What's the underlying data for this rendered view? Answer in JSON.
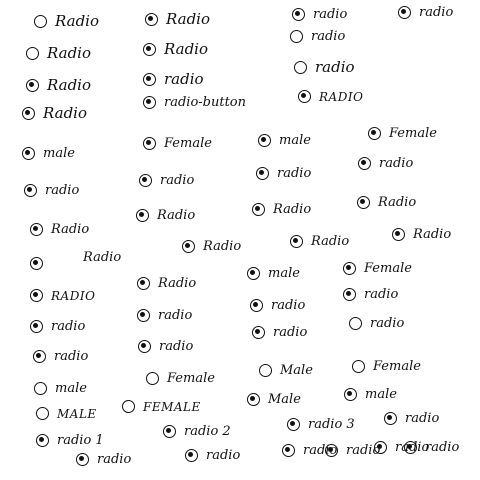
{
  "rows": [
    {
      "items": [
        {
          "label": "Radio",
          "selected": false
        },
        {
          "label": "Radio",
          "selected": true
        },
        {
          "label": "radio",
          "selected": true
        },
        {
          "label": "radio",
          "selected": true
        }
      ]
    },
    {
      "items": [
        {
          "label": "Radio",
          "selected": false
        },
        {
          "label": "Radio",
          "selected": true
        },
        {
          "label": "radio",
          "selected": false
        }
      ]
    },
    {
      "items": [
        {
          "label": "Radio",
          "selected": true
        },
        {
          "label": "radio",
          "selected": true
        },
        {
          "label": "radio",
          "selected": false
        }
      ]
    },
    {
      "items": [
        {
          "label": "Radio",
          "selected": true
        },
        {
          "label": "radio-button",
          "selected": true
        },
        {
          "label": "RADIO",
          "selected": true
        }
      ]
    },
    {
      "items": [
        {
          "label": "male",
          "selected": true
        },
        {
          "label": "Female",
          "selected": true
        },
        {
          "label": "male",
          "selected": true
        },
        {
          "label": "Female",
          "selected": true
        }
      ]
    },
    {
      "items": [
        {
          "label": "radio",
          "selected": true
        },
        {
          "label": "radio",
          "selected": true
        },
        {
          "label": "radio",
          "selected": true
        },
        {
          "label": "radio",
          "selected": true
        }
      ]
    },
    {
      "items": [
        {
          "label": "Radio",
          "selected": true
        },
        {
          "label": "Radio",
          "selected": true
        },
        {
          "label": "Radio",
          "selected": true
        },
        {
          "label": "Radio",
          "selected": true
        }
      ]
    },
    {
      "items": [
        {
          "label": "Radio",
          "selected": true
        },
        {
          "label": "Radio",
          "selected": true
        },
        {
          "label": "Radio",
          "selected": true
        },
        {
          "label": "Radio",
          "selected": true
        }
      ]
    },
    {
      "items": [
        {
          "label": "RADIO",
          "selected": true
        },
        {
          "label": "Radio",
          "selected": true
        },
        {
          "label": "male",
          "selected": true
        },
        {
          "label": "Female",
          "selected": true
        }
      ]
    },
    {
      "items": [
        {
          "label": "radio",
          "selected": true
        },
        {
          "label": "radio",
          "selected": true
        },
        {
          "label": "radio",
          "selected": true
        },
        {
          "label": "radio",
          "selected": true
        }
      ]
    },
    {
      "items": [
        {
          "label": "radio",
          "selected": true
        },
        {
          "label": "radio",
          "selected": false
        }
      ]
    },
    {
      "items": [
        {
          "label": "radio",
          "selected": true
        },
        {
          "label": "radio",
          "selected": true
        }
      ]
    },
    {
      "items": [
        {
          "label": "male",
          "selected": false
        },
        {
          "label": "Female",
          "selected": false
        },
        {
          "label": "Male",
          "selected": false
        },
        {
          "label": "Female",
          "selected": false
        }
      ]
    },
    {
      "items": [
        {
          "label": "MALE",
          "selected": false
        },
        {
          "label": "FEMALE",
          "selected": false
        },
        {
          "label": "Male",
          "selected": true
        },
        {
          "label": "male",
          "selected": true
        }
      ]
    },
    {
      "items": [
        {
          "label": "radio 1",
          "selected": true
        },
        {
          "label": "radio 2",
          "selected": true
        },
        {
          "label": "radio 3",
          "selected": true
        },
        {
          "label": "radio",
          "selected": true
        }
      ]
    },
    {
      "items": [
        {
          "label": "radio",
          "selected": true
        },
        {
          "label": "radio",
          "selected": true
        },
        {
          "label": "radio",
          "selected": true
        },
        {
          "label": "radio",
          "selected": true
        },
        {
          "label": "radio",
          "selected": true
        },
        {
          "label": "radio",
          "selected": true
        }
      ]
    }
  ]
}
